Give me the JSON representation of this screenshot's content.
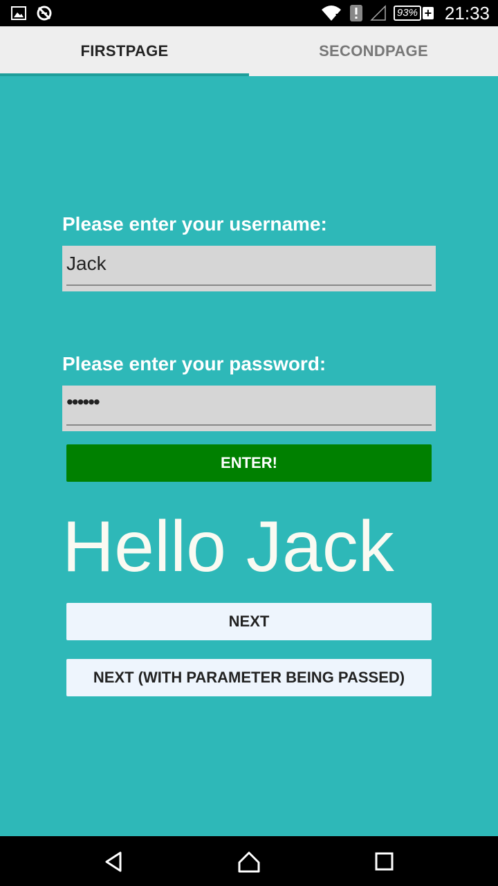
{
  "status_bar": {
    "battery_percent": "93%",
    "time": "21:33",
    "left_icons": [
      "image-icon",
      "no-sync-icon"
    ],
    "right_icons": [
      "wifi-icon",
      "alert-icon",
      "no-signal-icon"
    ]
  },
  "tabs": [
    {
      "label": "FIRSTPAGE",
      "active": true
    },
    {
      "label": "SECONDPAGE",
      "active": false
    }
  ],
  "form": {
    "username_label": "Please enter your username:",
    "username_value": "Jack",
    "password_label": "Please enter your password:",
    "password_value": "••••••",
    "enter_label": "ENTER!"
  },
  "greeting": "Hello Jack",
  "buttons": {
    "next_label": "NEXT",
    "next_param_label": "NEXT (WITH PARAMETER BEING PASSED)"
  },
  "colors": {
    "background": "#2eb8b8",
    "enter_button": "#008000",
    "tab_indicator": "#1e9e9a"
  },
  "nav": [
    "back-icon",
    "home-icon",
    "recents-icon"
  ]
}
